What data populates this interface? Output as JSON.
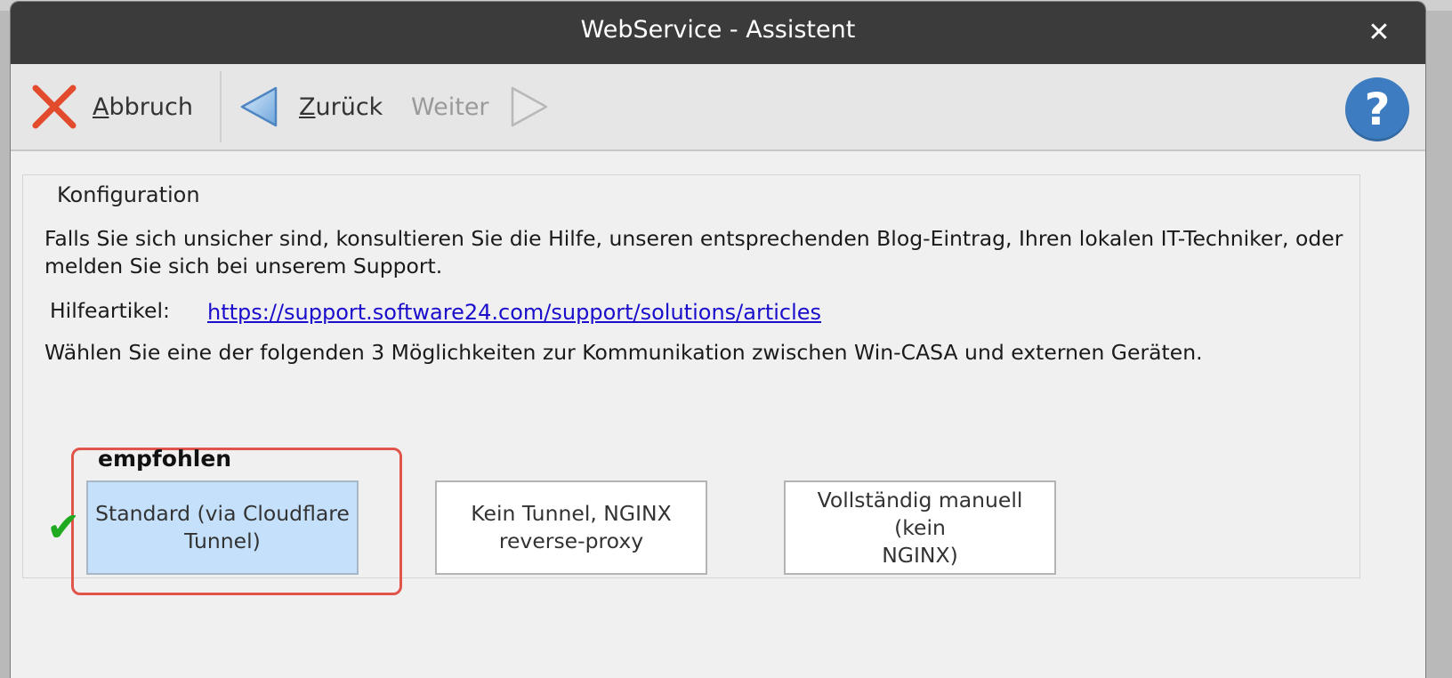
{
  "window": {
    "title": "WebService - Assistent"
  },
  "toolbar": {
    "cancel": {
      "accel": "A",
      "rest": "bbruch"
    },
    "back": {
      "accel": "Z",
      "rest": "urück"
    },
    "next": {
      "label": "Weiter"
    },
    "help_glyph": "?"
  },
  "config": {
    "group_title": "Konfiguration",
    "intro_line1": "Falls Sie sich unsicher sind, konsultieren Sie die Hilfe, unseren entsprechenden Blog-Eintrag, Ihren lokalen IT-Techniker, oder",
    "intro_line2": "melden Sie sich bei unserem Support.",
    "help_label": "Hilfeartikel:",
    "help_url": "https://support.software24.com/support/solutions/articles",
    "choose_text": "Wählen Sie eine der folgenden 3 Möglichkeiten zur Kommunikation zwischen Win-CASA und externen Geräten.",
    "recommended_label": "empfohlen",
    "options": [
      {
        "label_line1": "Standard (via Cloudflare",
        "label_line2": "Tunnel)",
        "selected": true
      },
      {
        "label_line1": "Kein Tunnel, NGINX",
        "label_line2": "reverse-proxy",
        "selected": false
      },
      {
        "label_line1": "Vollständig manuell (kein",
        "label_line2": "NGINX)",
        "selected": false
      }
    ]
  },
  "colors": {
    "titlebar": "#3b3b3b",
    "selected_option": "#c5e0fb",
    "highlight_frame": "#e0544a",
    "checkmark": "#1faa1f",
    "help_button": "#3d7cc0",
    "link": "#1a0dcc"
  },
  "icons": {
    "close": "close-icon",
    "cancel": "red-x-icon",
    "back": "left-triangle-icon",
    "next": "right-triangle-icon",
    "help": "question-mark-icon",
    "check": "checkmark-icon"
  }
}
